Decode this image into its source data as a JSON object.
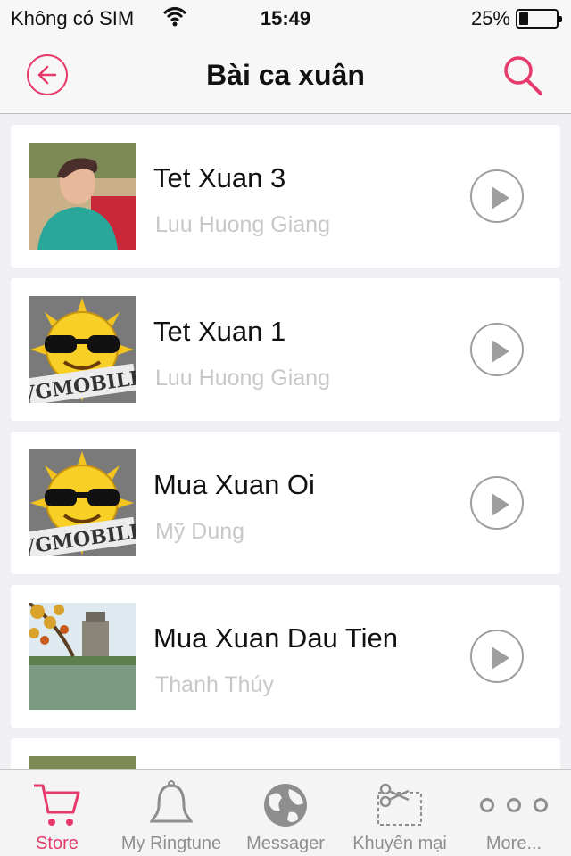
{
  "status_bar": {
    "carrier": "Không có SIM",
    "time": "15:49",
    "battery": "25%",
    "battery_level": 0.25
  },
  "nav": {
    "title": "Bài ca xuân"
  },
  "songs": [
    {
      "title": "Tet Xuan 3",
      "artist": "Luu Huong Giang",
      "thumb": "singer-photo"
    },
    {
      "title": "Tet Xuan 1",
      "artist": "Luu Huong Giang",
      "thumb": "vgmobile-sun-logo"
    },
    {
      "title": "Mua Xuan Oi",
      "artist": "Mỹ Dung",
      "thumb": "vgmobile-sun-logo"
    },
    {
      "title": "Mua Xuan Dau Tien",
      "artist": "Thanh Thúy",
      "thumb": "lake-pagoda-photo"
    },
    {
      "title": "",
      "artist": "",
      "thumb": "singer-photo"
    }
  ],
  "tabs": [
    {
      "label": "Store",
      "icon": "cart-icon",
      "active": true
    },
    {
      "label": "My Ringtune",
      "icon": "bell-icon",
      "active": false
    },
    {
      "label": "Messager",
      "icon": "globe-icon",
      "active": false
    },
    {
      "label": "Khuyến mại",
      "icon": "scissors-icon",
      "active": false
    },
    {
      "label": "More...",
      "icon": "more-dots-icon",
      "active": false
    }
  ],
  "colors": {
    "accent": "#e53a6b",
    "inactive": "#8e8e8e"
  }
}
